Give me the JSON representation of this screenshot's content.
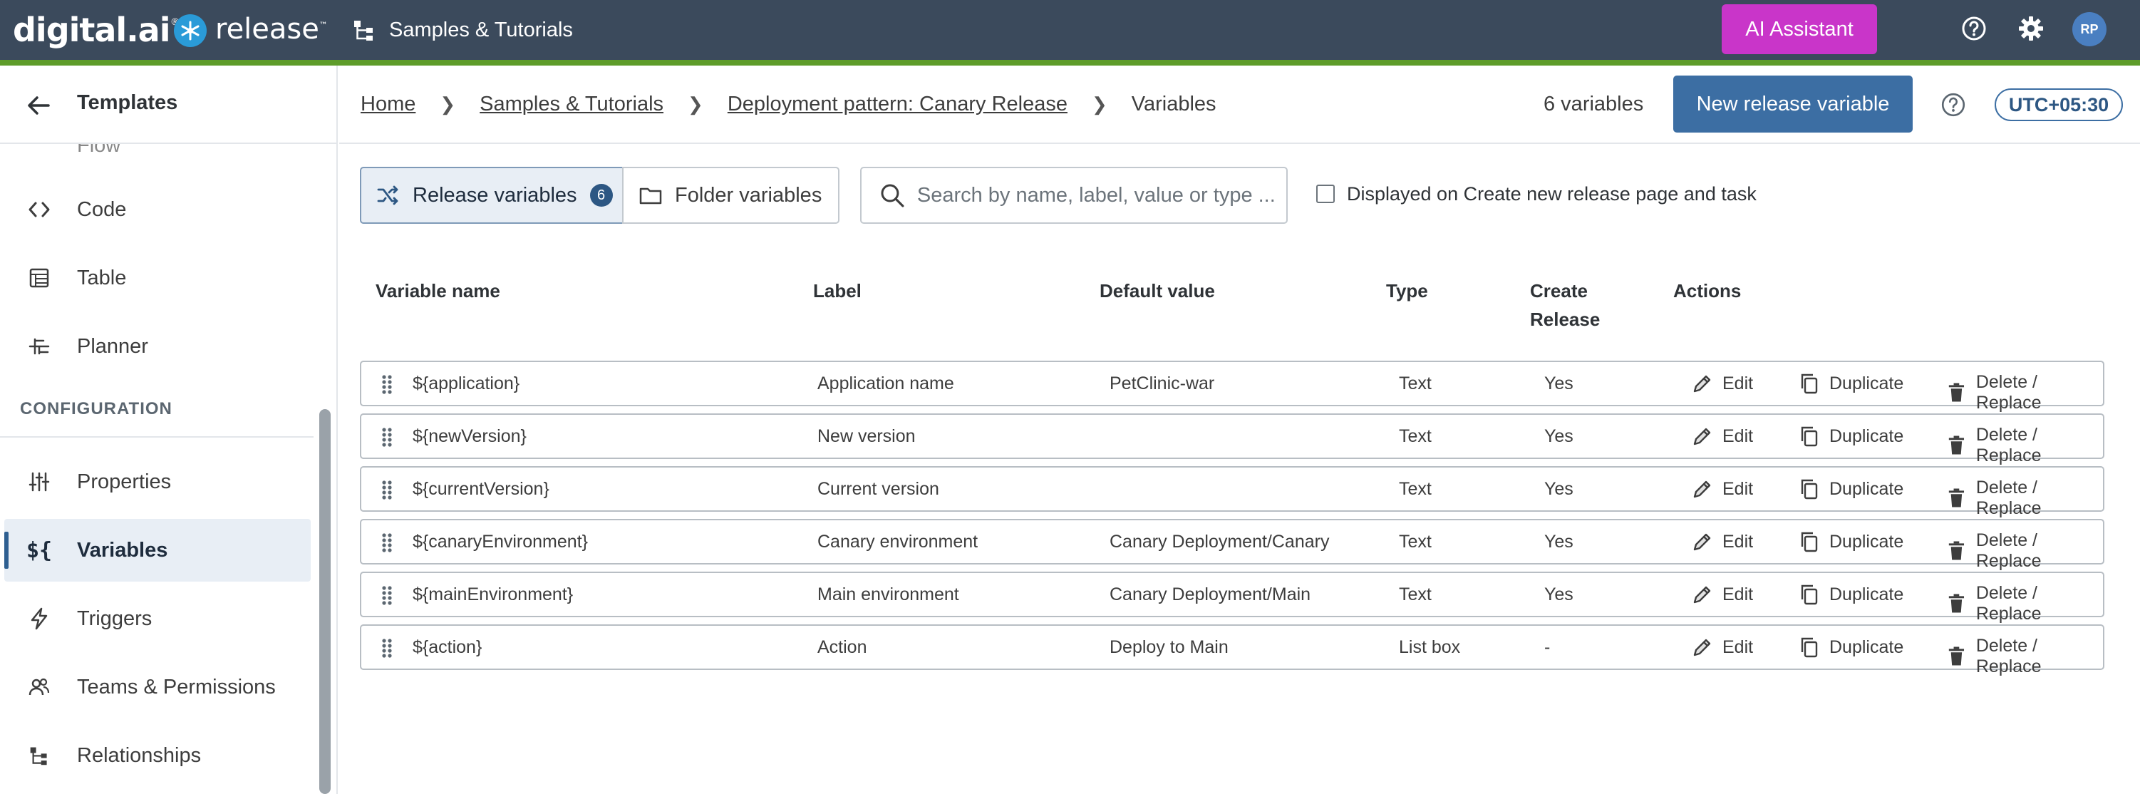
{
  "topbar": {
    "brand": "digital.ai",
    "product": "release",
    "folder": "Samples & Tutorials",
    "ai_assistant": "AI Assistant",
    "avatar_initials": "RP",
    "colors": {
      "bar": "#3b4a5c",
      "accent": "#5e9c2a",
      "ai": "#c935c9"
    }
  },
  "sidebar": {
    "title": "Templates",
    "items": [
      {
        "label": "Flow",
        "icon": "flow-icon"
      },
      {
        "label": "Code",
        "icon": "code-icon"
      },
      {
        "label": "Table",
        "icon": "table-icon"
      },
      {
        "label": "Planner",
        "icon": "planner-icon"
      }
    ],
    "section": "CONFIGURATION",
    "config_items": [
      {
        "label": "Properties",
        "icon": "sliders-icon"
      },
      {
        "label": "Variables",
        "icon": "variables-icon",
        "active": true
      },
      {
        "label": "Triggers",
        "icon": "bolt-icon"
      },
      {
        "label": "Teams & Permissions",
        "icon": "users-icon"
      },
      {
        "label": "Relationships",
        "icon": "hierarchy-icon"
      }
    ]
  },
  "header": {
    "breadcrumb": [
      "Home",
      "Samples & Tutorials",
      "Deployment pattern: Canary Release",
      "Variables"
    ],
    "count": "6 variables",
    "new_button": "New release variable",
    "timezone": "UTC+05:30"
  },
  "filters": {
    "release_tab": "Release variables",
    "release_count": "6",
    "folder_tab": "Folder variables",
    "search_placeholder": "Search by name, label, value or type ...",
    "checkbox_label": "Displayed on Create new release page and task"
  },
  "table": {
    "columns": [
      "Variable name",
      "Label",
      "Default value",
      "Type",
      "Create Release",
      "Actions"
    ],
    "actions": {
      "edit": "Edit",
      "duplicate": "Duplicate",
      "delete": "Delete / Replace"
    },
    "rows": [
      {
        "name": "${application}",
        "label": "Application name",
        "default": "PetClinic-war",
        "type": "Text",
        "create": "Yes"
      },
      {
        "name": "${newVersion}",
        "label": "New version",
        "default": "",
        "type": "Text",
        "create": "Yes"
      },
      {
        "name": "${currentVersion}",
        "label": "Current version",
        "default": "",
        "type": "Text",
        "create": "Yes"
      },
      {
        "name": "${canaryEnvironment}",
        "label": "Canary environment",
        "default": "Canary Deployment/Canary",
        "type": "Text",
        "create": "Yes"
      },
      {
        "name": "${mainEnvironment}",
        "label": "Main environment",
        "default": "Canary Deployment/Main",
        "type": "Text",
        "create": "Yes"
      },
      {
        "name": "${action}",
        "label": "Action",
        "default": "Deploy to Main",
        "type": "List box",
        "create": "-"
      }
    ]
  }
}
